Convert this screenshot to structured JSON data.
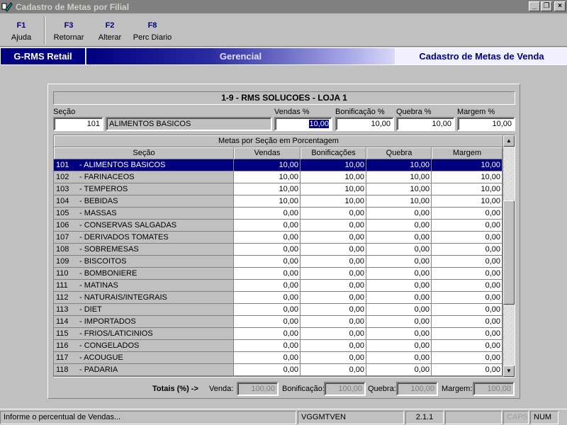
{
  "window": {
    "title": "Cadastro de Metas por Filial",
    "controls": {
      "minimize": "_",
      "restore": "❐",
      "close": "×"
    }
  },
  "toolbar": [
    {
      "key": "F1",
      "label": "Ajuda"
    },
    {
      "key": "F3",
      "label": "Retornar"
    },
    {
      "key": "F2",
      "label": "Alterar"
    },
    {
      "key": "F8",
      "label": "Perc Diario"
    }
  ],
  "banner": {
    "product": "G-RMS Retail",
    "module": "Gerencial",
    "screen": "Cadastro de Metas de Venda"
  },
  "store": "1-9 - RMS SOLUCOES - LOJA 1",
  "form": {
    "secao_label": "Seção",
    "secao_code": "101",
    "secao_name": "ALIMENTOS BASICOS",
    "vendas_label": "Vendas %",
    "vendas_value": "10,00",
    "bonif_label": "Bonificação %",
    "bonif_value": "10,00",
    "quebra_label": "Quebra %",
    "quebra_value": "10,00",
    "margem_label": "Margem %",
    "margem_value": "10,00"
  },
  "grid": {
    "caption": "Metas por Seção em Porcentagem",
    "columns": [
      "Seção",
      "Vendas",
      "Bonificações",
      "Quebra",
      "Margem"
    ],
    "selected_index": 0,
    "rows": [
      {
        "code": "101",
        "name": "- ALIMENTOS BASICOS",
        "vendas": "10,00",
        "bonif": "10,00",
        "quebra": "10,00",
        "margem": "10,00"
      },
      {
        "code": "102",
        "name": "- FARINACEOS",
        "vendas": "10,00",
        "bonif": "10,00",
        "quebra": "10,00",
        "margem": "10,00"
      },
      {
        "code": "103",
        "name": "- TEMPEROS",
        "vendas": "10,00",
        "bonif": "10,00",
        "quebra": "10,00",
        "margem": "10,00"
      },
      {
        "code": "104",
        "name": "- BEBIDAS",
        "vendas": "10,00",
        "bonif": "10,00",
        "quebra": "10,00",
        "margem": "10,00"
      },
      {
        "code": "105",
        "name": "- MASSAS",
        "vendas": "0,00",
        "bonif": "0,00",
        "quebra": "0,00",
        "margem": "0,00"
      },
      {
        "code": "106",
        "name": "- CONSERVAS SALGADAS",
        "vendas": "0,00",
        "bonif": "0,00",
        "quebra": "0,00",
        "margem": "0,00"
      },
      {
        "code": "107",
        "name": "- DERIVADOS TOMATES",
        "vendas": "0,00",
        "bonif": "0,00",
        "quebra": "0,00",
        "margem": "0,00"
      },
      {
        "code": "108",
        "name": "- SOBREMESAS",
        "vendas": "0,00",
        "bonif": "0,00",
        "quebra": "0,00",
        "margem": "0,00"
      },
      {
        "code": "109",
        "name": "- BISCOITOS",
        "vendas": "0,00",
        "bonif": "0,00",
        "quebra": "0,00",
        "margem": "0,00"
      },
      {
        "code": "110",
        "name": "- BOMBONIERE",
        "vendas": "0,00",
        "bonif": "0,00",
        "quebra": "0,00",
        "margem": "0,00"
      },
      {
        "code": "111",
        "name": "- MATINAS",
        "vendas": "0,00",
        "bonif": "0,00",
        "quebra": "0,00",
        "margem": "0,00"
      },
      {
        "code": "112",
        "name": "- NATURAIS/INTEGRAIS",
        "vendas": "0,00",
        "bonif": "0,00",
        "quebra": "0,00",
        "margem": "0,00"
      },
      {
        "code": "113",
        "name": "- DIET",
        "vendas": "0,00",
        "bonif": "0,00",
        "quebra": "0,00",
        "margem": "0,00"
      },
      {
        "code": "114",
        "name": "- IMPORTADOS",
        "vendas": "0,00",
        "bonif": "0,00",
        "quebra": "0,00",
        "margem": "0,00"
      },
      {
        "code": "115",
        "name": "- FRIOS/LATICINIOS",
        "vendas": "0,00",
        "bonif": "0,00",
        "quebra": "0,00",
        "margem": "0,00"
      },
      {
        "code": "116",
        "name": "- CONGELADOS",
        "vendas": "0,00",
        "bonif": "0,00",
        "quebra": "0,00",
        "margem": "0,00"
      },
      {
        "code": "117",
        "name": "- ACOUGUE",
        "vendas": "0,00",
        "bonif": "0,00",
        "quebra": "0,00",
        "margem": "0,00"
      },
      {
        "code": "118",
        "name": "- PADARIA",
        "vendas": "0,00",
        "bonif": "0,00",
        "quebra": "0,00",
        "margem": "0,00"
      }
    ],
    "scroll": {
      "up": "▲",
      "down": "▼"
    }
  },
  "totals": {
    "label": "Totais (%) ->",
    "venda_label": "Venda:",
    "venda_value": "100,00",
    "bonif_label": "Bonificação:",
    "bonif_value": "100,00",
    "quebra_label": "Quebra:",
    "quebra_value": "100,00",
    "margem_label": "Margem:",
    "margem_value": "100,00"
  },
  "status": {
    "message": "Informe o percentual de Vendas...",
    "program": "VGGMTVEN",
    "version": "2.1.1",
    "caps": "CAPS",
    "num": "NUM"
  },
  "colors": {
    "selection": "#000080",
    "face": "#c0c0c0"
  }
}
